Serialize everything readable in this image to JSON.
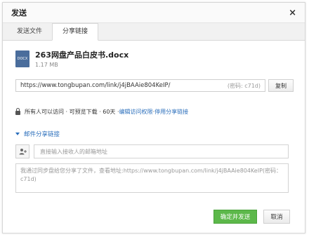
{
  "dialog": {
    "title": "发送",
    "close_glyph": "×"
  },
  "tabs": [
    {
      "label": "发送文件",
      "active": false
    },
    {
      "label": "分享链接",
      "active": true
    }
  ],
  "file": {
    "icon_label": "DOCX",
    "name": "263网盘产品白皮书.docx",
    "size": "1.17 MB"
  },
  "link": {
    "url": "https://www.tongbupan.com/link/j4jBAAie804KeIP/",
    "code": "(密码: c71d)",
    "copy_label": "复制"
  },
  "permissions": {
    "text": "所有人可以访问 · 可预览下载 · 60天 · ",
    "edit_label": "编辑访问权限",
    "separator": " · ",
    "disable_label": "停用分享链接"
  },
  "mail_share": {
    "label": "邮件分享链接"
  },
  "email": {
    "placeholder": "直接输入接收人的邮箱地址",
    "icon": "person-add-icon"
  },
  "message": {
    "text": "我通过同步盘给您分享了文件，查看地址:https://www.tongbupan.com/link/j4jBAAie804KeIP(密码：c71d)"
  },
  "actions": {
    "confirm_label": "确定并发送",
    "cancel_label": "取消"
  },
  "colors": {
    "accent": "#2a6ebb",
    "confirm": "#5cb84a"
  }
}
